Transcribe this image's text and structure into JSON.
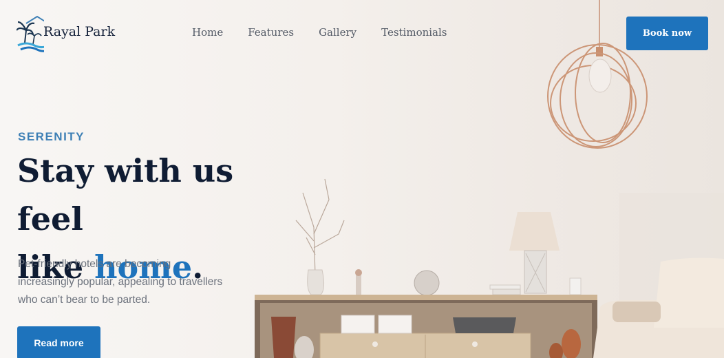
{
  "brand": {
    "name": "Rayal Park",
    "logo_icon": "palm-wave-logo"
  },
  "nav": {
    "items": [
      "Home",
      "Features",
      "Gallery",
      "Testimonials"
    ]
  },
  "header": {
    "cta_label": "Book now"
  },
  "hero": {
    "eyebrow": "SERENITY",
    "headline_line1": "Stay with us feel",
    "headline_line2_prefix": "like ",
    "headline_accent": "home",
    "headline_suffix": ".",
    "description": "Pet-friendly hotels are becoming increasingly popular, appealing to travellers who can’t bear to be parted.",
    "cta_label": "Read more"
  },
  "colors": {
    "accent": "#1e73bc",
    "heading": "#0f1c33",
    "eyebrow": "#3d7fb5"
  }
}
